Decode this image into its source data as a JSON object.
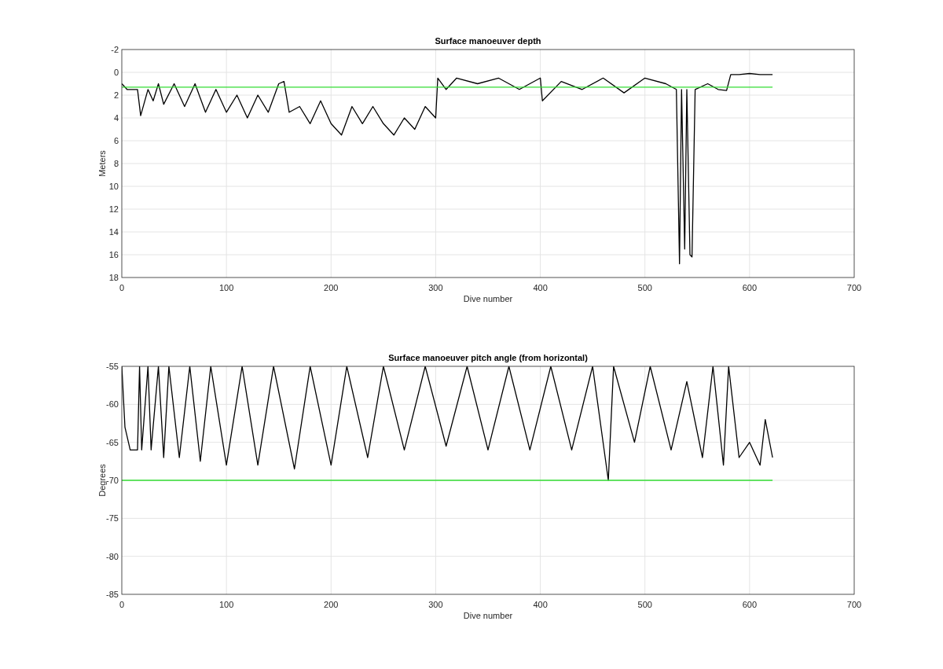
{
  "charts": [
    {
      "chart_data": {
        "type": "line",
        "title": "Surface manoeuver depth",
        "xlabel": "Dive number",
        "ylabel": "Meters",
        "grid": true,
        "xlim": [
          0,
          700
        ],
        "ylim": [
          18,
          -2
        ],
        "xticks": [
          0,
          100,
          200,
          300,
          400,
          500,
          600,
          700
        ],
        "yticks": [
          -2,
          0,
          2,
          4,
          6,
          8,
          10,
          12,
          14,
          16,
          18
        ],
        "series": [
          {
            "color": "#000000",
            "x": [
              0,
              5,
              10,
              15,
              18,
              25,
              30,
              35,
              40,
              50,
              60,
              70,
              80,
              90,
              100,
              110,
              120,
              130,
              140,
              150,
              155,
              160,
              170,
              180,
              190,
              200,
              210,
              220,
              230,
              240,
              250,
              260,
              270,
              280,
              290,
              300,
              302,
              310,
              320,
              340,
              360,
              380,
              400,
              402,
              420,
              440,
              460,
              480,
              500,
              520,
              530,
              533,
              535,
              538,
              540,
              543,
              545,
              548,
              560,
              570,
              578,
              582,
              590,
              600,
              610,
              622
            ],
            "values": [
              1,
              1.5,
              1.5,
              1.5,
              3.8,
              1.5,
              2.5,
              1,
              2.8,
              1,
              3,
              1,
              3.5,
              1.5,
              3.5,
              2,
              4,
              2,
              3.5,
              1,
              0.8,
              3.5,
              3,
              4.5,
              2.5,
              4.5,
              5.5,
              3,
              4.5,
              3,
              4.5,
              5.5,
              4,
              5,
              3,
              4,
              0.5,
              1.5,
              0.5,
              1,
              0.5,
              1.5,
              0.5,
              2.5,
              0.8,
              1.5,
              0.5,
              1.8,
              0.5,
              1,
              1.5,
              16.8,
              1.5,
              15.5,
              1.5,
              16,
              16.2,
              1.5,
              1,
              1.5,
              1.6,
              0.2,
              0.2,
              0.1,
              0.2,
              0.2
            ]
          },
          {
            "color": "#33dd33",
            "x": [
              0,
              622
            ],
            "values": [
              1.3,
              1.3
            ]
          }
        ]
      }
    },
    {
      "chart_data": {
        "type": "line",
        "title": "Surface manoeuver pitch angle (from horizontal)",
        "xlabel": "Dive number",
        "ylabel": "Degrees",
        "grid": true,
        "xlim": [
          0,
          700
        ],
        "ylim": [
          -85,
          -55
        ],
        "xticks": [
          0,
          100,
          200,
          300,
          400,
          500,
          600,
          700
        ],
        "yticks": [
          -85,
          -80,
          -75,
          -70,
          -65,
          -60,
          -55
        ],
        "series": [
          {
            "color": "#000000",
            "x": [
              0,
              3,
              8,
              15,
              17,
              19,
              25,
              28,
              35,
              40,
              45,
              55,
              65,
              75,
              85,
              100,
              115,
              130,
              145,
              165,
              180,
              200,
              215,
              235,
              250,
              270,
              290,
              310,
              330,
              350,
              370,
              390,
              410,
              430,
              450,
              465,
              470,
              490,
              505,
              525,
              540,
              555,
              565,
              575,
              580,
              590,
              600,
              610,
              615,
              622
            ],
            "values": [
              -55,
              -63,
              -66,
              -66,
              -55,
              -66,
              -55,
              -66,
              -55,
              -67,
              -55,
              -67,
              -55,
              -67.5,
              -55,
              -68,
              -55,
              -68,
              -55,
              -68.5,
              -55,
              -68,
              -55,
              -67,
              -55,
              -66,
              -55,
              -65.5,
              -55,
              -66,
              -55,
              -66,
              -55,
              -66,
              -55,
              -70,
              -55,
              -65,
              -55,
              -66,
              -57,
              -67,
              -55,
              -68,
              -55,
              -67,
              -65,
              -68,
              -62,
              -67
            ]
          },
          {
            "color": "#33dd33",
            "x": [
              0,
              622
            ],
            "values": [
              -70,
              -70
            ]
          }
        ]
      }
    }
  ]
}
